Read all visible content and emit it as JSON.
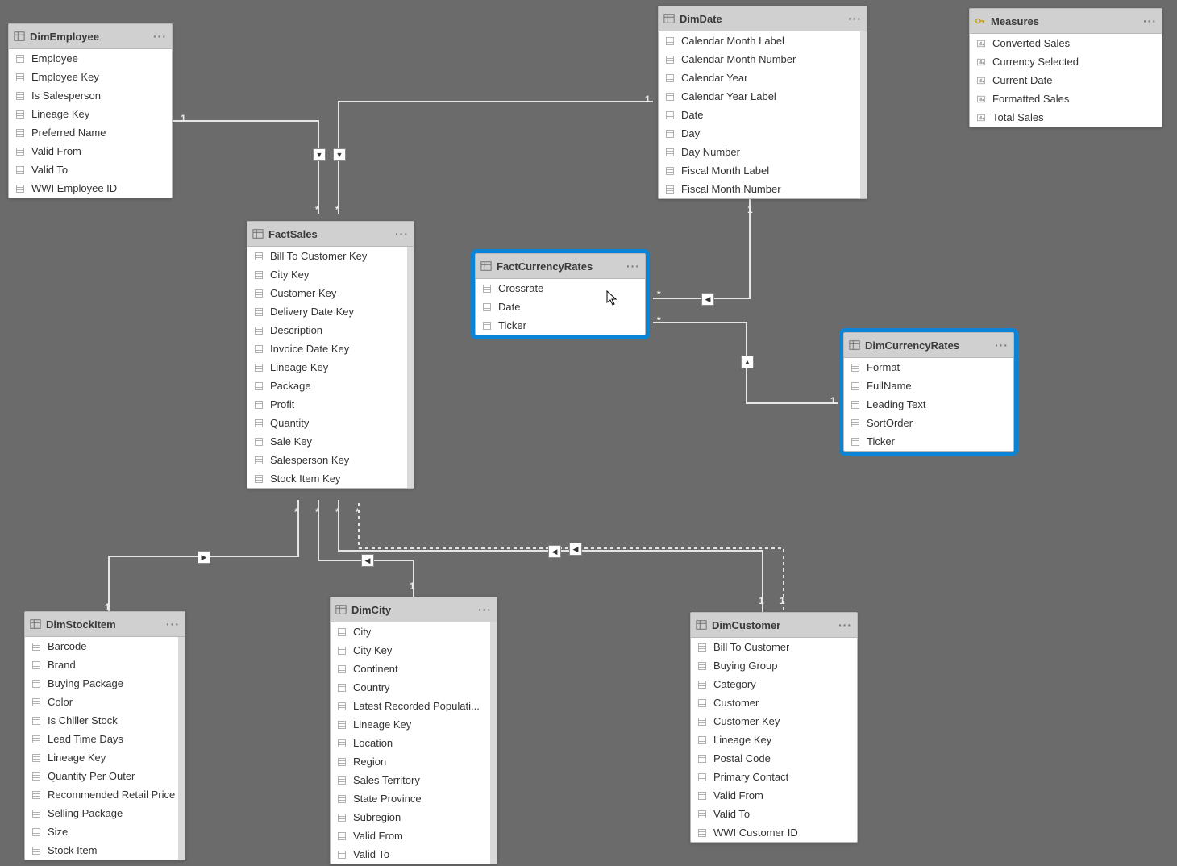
{
  "tables": {
    "dimEmployee": {
      "title": "DimEmployee",
      "fields": [
        "Employee",
        "Employee Key",
        "Is Salesperson",
        "Lineage Key",
        "Preferred Name",
        "Valid From",
        "Valid To",
        "WWI Employee ID"
      ]
    },
    "factSales": {
      "title": "FactSales",
      "fields": [
        "Bill To Customer Key",
        "City Key",
        "Customer Key",
        "Delivery Date Key",
        "Description",
        "Invoice Date Key",
        "Lineage Key",
        "Package",
        "Profit",
        "Quantity",
        "Sale Key",
        "Salesperson Key",
        "Stock Item Key"
      ]
    },
    "dimDate": {
      "title": "DimDate",
      "fields": [
        "Calendar Month Label",
        "Calendar Month Number",
        "Calendar Year",
        "Calendar Year Label",
        "Date",
        "Day",
        "Day Number",
        "Fiscal Month Label",
        "Fiscal Month Number"
      ]
    },
    "measures": {
      "title": "Measures",
      "fields": [
        "Converted Sales",
        "Currency Selected",
        "Current Date",
        "Formatted Sales",
        "Total Sales"
      ]
    },
    "factCurrencyRates": {
      "title": "FactCurrencyRates",
      "fields": [
        "Crossrate",
        "Date",
        "Ticker"
      ]
    },
    "dimCurrencyRates": {
      "title": "DimCurrencyRates",
      "fields": [
        "Format",
        "FullName",
        "Leading Text",
        "SortOrder",
        "Ticker"
      ]
    },
    "dimStockItem": {
      "title": "DimStockItem",
      "fields": [
        "Barcode",
        "Brand",
        "Buying Package",
        "Color",
        "Is Chiller Stock",
        "Lead Time Days",
        "Lineage Key",
        "Quantity Per Outer",
        "Recommended Retail Price",
        "Selling Package",
        "Size",
        "Stock Item"
      ]
    },
    "dimCity": {
      "title": "DimCity",
      "fields": [
        "City",
        "City Key",
        "Continent",
        "Country",
        "Latest Recorded Populati...",
        "Lineage Key",
        "Location",
        "Region",
        "Sales Territory",
        "State Province",
        "Subregion",
        "Valid From",
        "Valid To"
      ]
    },
    "dimCustomer": {
      "title": "DimCustomer",
      "fields": [
        "Bill To Customer",
        "Buying Group",
        "Category",
        "Customer",
        "Customer Key",
        "Lineage Key",
        "Postal Code",
        "Primary Contact",
        "Valid From",
        "Valid To",
        "WWI Customer ID"
      ]
    }
  },
  "cardinality": {
    "one": "1",
    "many": "*"
  },
  "dots": "···"
}
